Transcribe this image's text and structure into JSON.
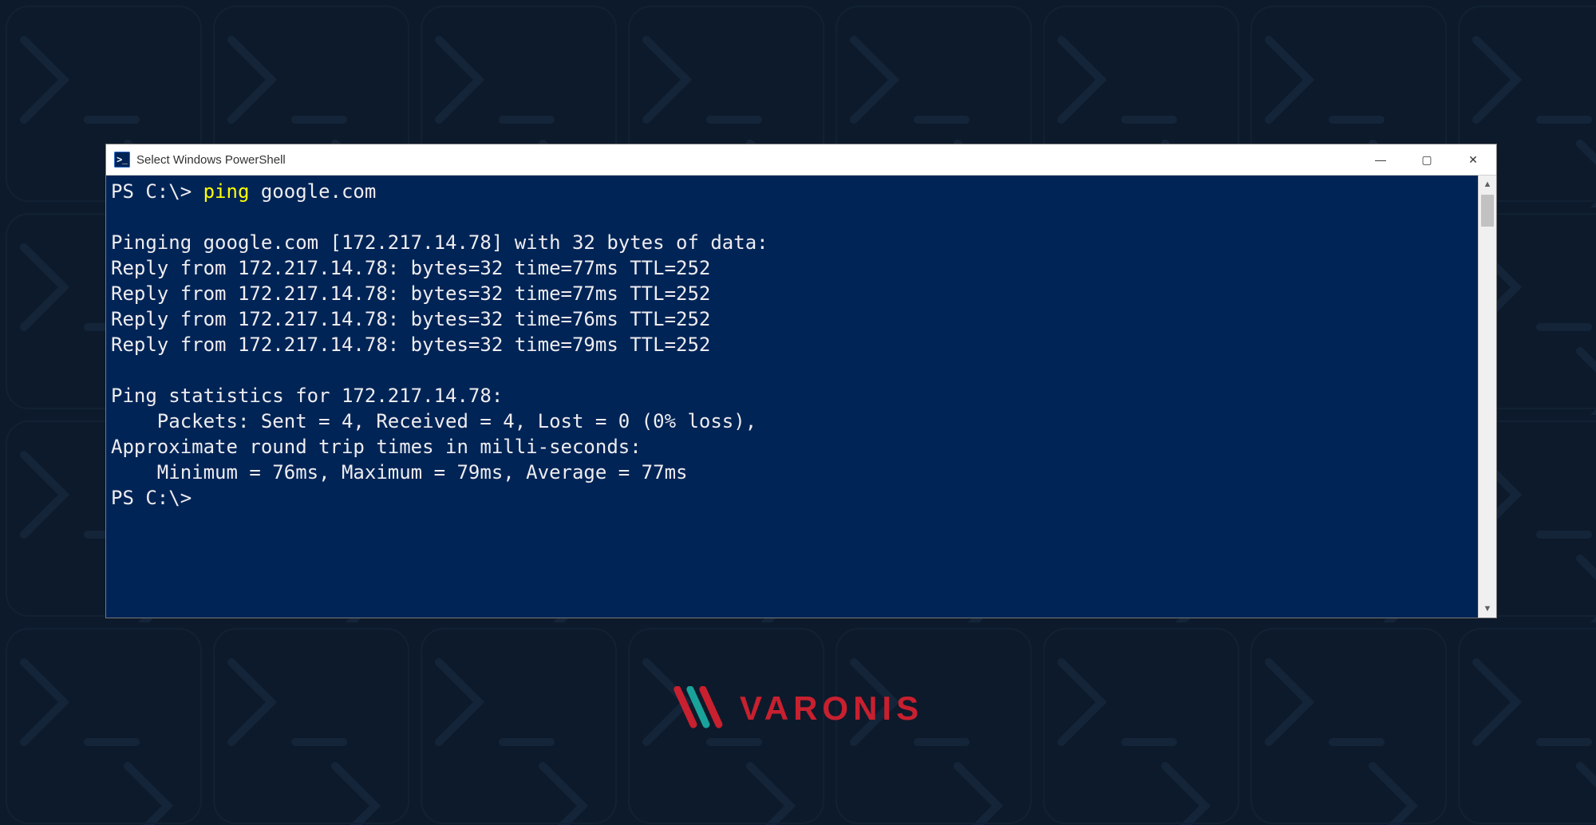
{
  "window": {
    "title": "Select Windows PowerShell",
    "icon_glyph": ">_",
    "controls": {
      "minimize": "—",
      "maximize": "▢",
      "close": "✕"
    }
  },
  "terminal": {
    "prompt1_prefix": "PS C:\\> ",
    "prompt1_cmd": "ping",
    "prompt1_rest": " google.com",
    "lines": [
      "",
      "Pinging google.com [172.217.14.78] with 32 bytes of data:",
      "Reply from 172.217.14.78: bytes=32 time=77ms TTL=252",
      "Reply from 172.217.14.78: bytes=32 time=77ms TTL=252",
      "Reply from 172.217.14.78: bytes=32 time=76ms TTL=252",
      "Reply from 172.217.14.78: bytes=32 time=79ms TTL=252",
      "",
      "Ping statistics for 172.217.14.78:",
      "    Packets: Sent = 4, Received = 4, Lost = 0 (0% loss),",
      "Approximate round trip times in milli-seconds:",
      "    Minimum = 76ms, Maximum = 79ms, Average = 77ms"
    ],
    "prompt2": "PS C:\\>"
  },
  "scrollbar": {
    "up": "▲",
    "down": "▼"
  },
  "logo": {
    "text": "VARONIS"
  },
  "colors": {
    "terminal_bg": "#012456",
    "terminal_fg": "#eeedf0",
    "cmd_highlight": "#ffff00",
    "brand_red": "#c8202f",
    "brand_teal": "#1aa39a"
  }
}
